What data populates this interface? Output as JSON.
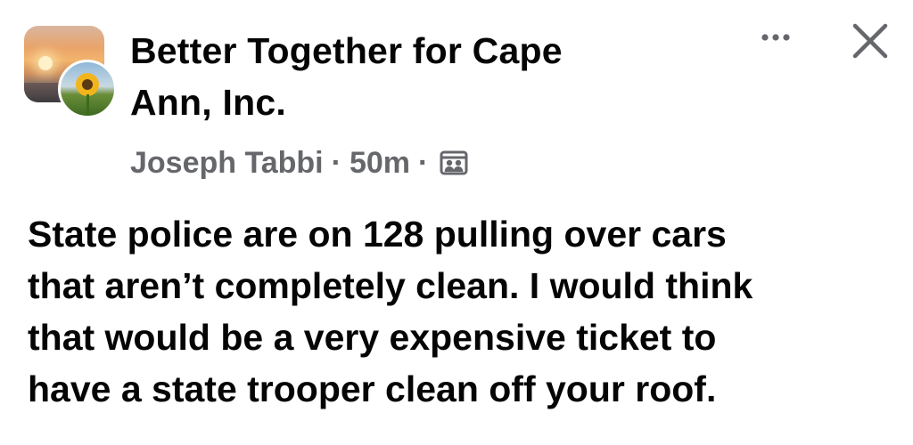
{
  "post": {
    "group_name": "Better Together for Cape\nAnn, Inc.",
    "author": "Joseph Tabbi",
    "separator": "·",
    "timestamp": "50m",
    "audience_icon": "group-members-icon",
    "body": "State police are on 128 pulling over cars\nthat aren’t completely clean. I would think\nthat would be a very expensive ticket to\nhave a state trooper clean off your roof."
  },
  "actions": {
    "more_icon": "more-options-icon",
    "close_icon": "close-icon"
  },
  "colors": {
    "text_primary": "#050505",
    "text_secondary": "#65676b",
    "icon": "#65676b",
    "background": "#ffffff"
  }
}
